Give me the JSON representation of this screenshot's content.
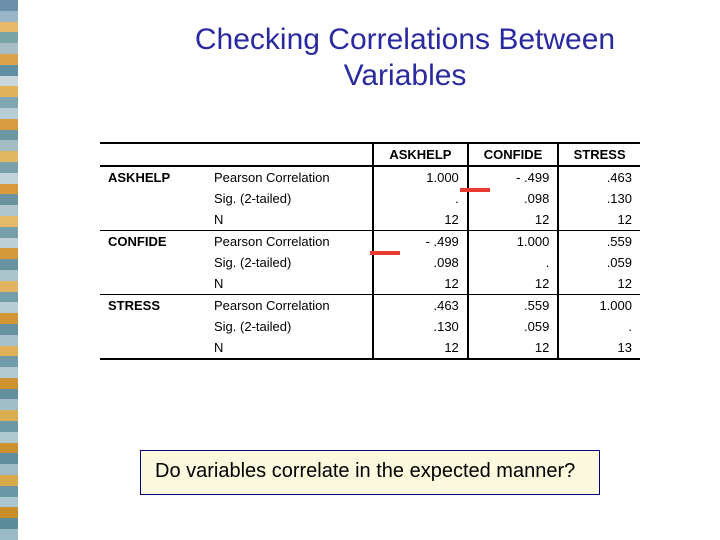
{
  "title": "Checking Correlations Between Variables",
  "callout": "Do variables correlate in the expected manner?",
  "columns": [
    "ASKHELP",
    "CONFIDE",
    "STRESS"
  ],
  "stats": [
    "Pearson Correlation",
    "Sig. (2-tailed)",
    "N"
  ],
  "vars": {
    "ASKHELP": {
      "pearson": [
        "1.000",
        "- .499",
        ".463"
      ],
      "sig": [
        ".",
        ".098",
        ".130"
      ],
      "n": [
        "12",
        "12",
        "12"
      ]
    },
    "CONFIDE": {
      "pearson": [
        "- .499",
        "1.000",
        ".559"
      ],
      "sig": [
        ".098",
        ".",
        ".059"
      ],
      "n": [
        "12",
        "12",
        "12"
      ]
    },
    "STRESS": {
      "pearson": [
        ".463",
        ".559",
        "1.000"
      ],
      "sig": [
        ".130",
        ".059",
        "."
      ],
      "n": [
        "12",
        "12",
        "13"
      ]
    }
  },
  "sidebar_colors": [
    "#6b8fa8",
    "#9ab7c9",
    "#e6b86a",
    "#7aa3a3",
    "#a7bec6",
    "#dca24c",
    "#5f8ea0",
    "#c7d7dc",
    "#e0b45a",
    "#82a6b0",
    "#b9cdd4",
    "#d79c3f",
    "#6d96a3",
    "#a3bdc5",
    "#e2b763",
    "#7aa0ab",
    "#c1d2d8",
    "#d89a3a",
    "#6a93a0",
    "#afc6cd",
    "#e4ba68",
    "#77a0ab",
    "#bcd0d6",
    "#d5983a",
    "#6893a1",
    "#aac4cc",
    "#e1b55f",
    "#739da9",
    "#b7ccd3",
    "#d29636",
    "#6591a0",
    "#a6c1ca",
    "#deb158",
    "#709ba8",
    "#b3cad1",
    "#cf9332",
    "#628f9e",
    "#a2bec8",
    "#dbad51",
    "#6d99a6",
    "#afc7cf",
    "#cc902e",
    "#5f8d9d",
    "#9ebcc6",
    "#d8a94a",
    "#6a97a5",
    "#abc5ce",
    "#c98e2a",
    "#5c8b9c",
    "#9abac5"
  ],
  "chart_data": {
    "type": "table",
    "title": "Correlation Matrix",
    "columns": [
      "",
      "",
      "ASKHELP",
      "CONFIDE",
      "STRESS"
    ],
    "rows": [
      [
        "ASKHELP",
        "Pearson Correlation",
        1.0,
        -0.499,
        0.463
      ],
      [
        "ASKHELP",
        "Sig. (2-tailed)",
        null,
        0.098,
        0.13
      ],
      [
        "ASKHELP",
        "N",
        12,
        12,
        12
      ],
      [
        "CONFIDE",
        "Pearson Correlation",
        -0.499,
        1.0,
        0.559
      ],
      [
        "CONFIDE",
        "Sig. (2-tailed)",
        0.098,
        null,
        0.059
      ],
      [
        "CONFIDE",
        "N",
        12,
        12,
        12
      ],
      [
        "STRESS",
        "Pearson Correlation",
        0.463,
        0.559,
        1.0
      ],
      [
        "STRESS",
        "Sig. (2-tailed)",
        0.13,
        0.059,
        null
      ],
      [
        "STRESS",
        "N",
        12,
        12,
        13
      ]
    ]
  }
}
